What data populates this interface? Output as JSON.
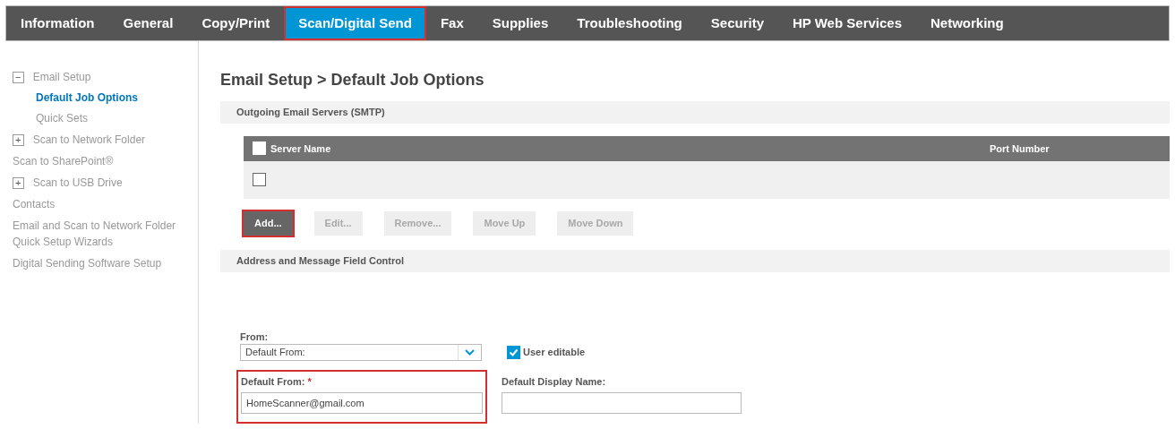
{
  "tabs": [
    {
      "label": "Information",
      "selected": false,
      "highlighted": false
    },
    {
      "label": "General",
      "selected": false,
      "highlighted": false
    },
    {
      "label": "Copy/Print",
      "selected": false,
      "highlighted": false
    },
    {
      "label": "Scan/Digital Send",
      "selected": true,
      "highlighted": true
    },
    {
      "label": "Fax",
      "selected": false,
      "highlighted": false
    },
    {
      "label": "Supplies",
      "selected": false,
      "highlighted": false
    },
    {
      "label": "Troubleshooting",
      "selected": false,
      "highlighted": false
    },
    {
      "label": "Security",
      "selected": false,
      "highlighted": false
    },
    {
      "label": "HP Web Services",
      "selected": false,
      "highlighted": false
    },
    {
      "label": "Networking",
      "selected": false,
      "highlighted": false
    }
  ],
  "sidebar": {
    "items": [
      {
        "label": "Email Setup",
        "expander": "−",
        "selected": false,
        "children": [
          {
            "label": "Default Job Options",
            "selected": true
          },
          {
            "label": "Quick Sets",
            "selected": false
          }
        ]
      },
      {
        "label": "Scan to Network Folder",
        "expander": "+",
        "selected": false
      },
      {
        "label": "Scan to SharePoint®",
        "selected": false
      },
      {
        "label": "Scan to USB Drive",
        "expander": "+",
        "selected": false
      },
      {
        "label": "Contacts",
        "selected": false
      },
      {
        "label": "Email and Scan to Network Folder Quick Setup Wizards",
        "selected": false
      },
      {
        "label": "Digital Sending Software Setup",
        "selected": false
      }
    ]
  },
  "page_title": "Email Setup > Default Job Options",
  "smtp_section": {
    "title": "Outgoing Email Servers (SMTP)",
    "table": {
      "columns": [
        "Server Name",
        "Port Number"
      ],
      "select_all_checked": false,
      "rows": [
        {
          "checked": false
        }
      ]
    },
    "buttons": [
      {
        "label": "Add...",
        "disabled": false,
        "highlighted": true
      },
      {
        "label": "Edit...",
        "disabled": true,
        "highlighted": false
      },
      {
        "label": "Remove...",
        "disabled": true,
        "highlighted": false
      },
      {
        "label": "Move Up",
        "disabled": true,
        "highlighted": false
      },
      {
        "label": "Move Down",
        "disabled": true,
        "highlighted": false
      }
    ]
  },
  "address_section": {
    "title": "Address and Message Field Control",
    "from": {
      "label": "From:",
      "value": "Default From:"
    },
    "user_editable": {
      "label": "User editable",
      "checked": true
    },
    "default_from": {
      "label": "Default From:",
      "required": "*",
      "value": "HomeScanner@gmail.com",
      "highlighted": true
    },
    "default_display_name": {
      "label": "Default Display Name:"
    }
  }
}
